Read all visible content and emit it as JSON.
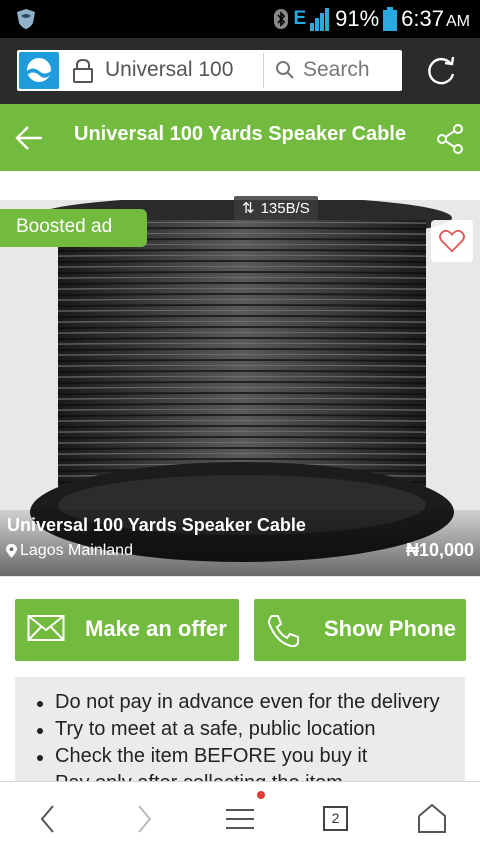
{
  "status_bar": {
    "network": "E",
    "battery": "91%",
    "time": "6:37",
    "ampm": "AM"
  },
  "browser": {
    "url_text": "Universal 100",
    "search_placeholder": "Search"
  },
  "header": {
    "title": "Universal 100 Yards Speaker Cable"
  },
  "listing": {
    "speed_badge": "135B/S",
    "boosted_label": "Boosted ad",
    "title": "Universal 100 Yards Speaker Cable",
    "location": "Lagos Mainland",
    "price": "₦10,000"
  },
  "actions": {
    "offer_label": "Make an offer",
    "phone_label": "Show Phone"
  },
  "tips": [
    "Do not pay in advance even for the delivery",
    "Try to meet at a safe, public location",
    "Check the item BEFORE you buy it",
    "Pay only after collecting the item"
  ],
  "bottom_nav": {
    "tab_count": "2"
  },
  "colors": {
    "brand_green": "#72bb3e",
    "browser_dark": "#2b2b2b",
    "logo_blue": "#1e9cdb",
    "notify_red": "#e53935"
  }
}
